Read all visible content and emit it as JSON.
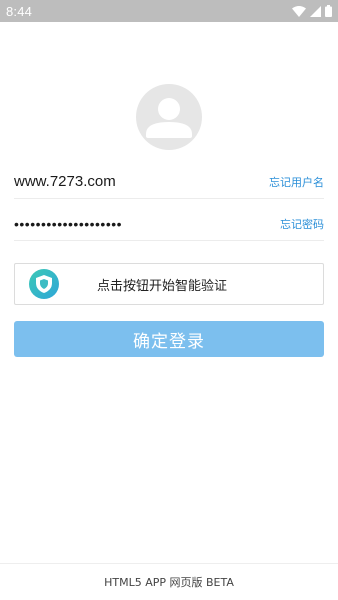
{
  "status_bar": {
    "time": "8:44",
    "icons": [
      "wifi-icon",
      "signal-icon",
      "battery-icon"
    ]
  },
  "avatar": {
    "icon": "user-avatar-icon"
  },
  "username": {
    "value": "www.7273.com",
    "forgot_label": "忘记用户名"
  },
  "password": {
    "value": "••••••••••••••••••••",
    "forgot_label": "忘记密码"
  },
  "captcha": {
    "icon": "shield-check-icon",
    "label": "点击按钮开始智能验证"
  },
  "login_button": {
    "label": "确定登录"
  },
  "footer": {
    "text": "HTML5 APP 网页版 BETA"
  },
  "colors": {
    "accent": "#2b8fd8",
    "button": "#7cbfee",
    "status_bar": "#bdbdbd"
  }
}
